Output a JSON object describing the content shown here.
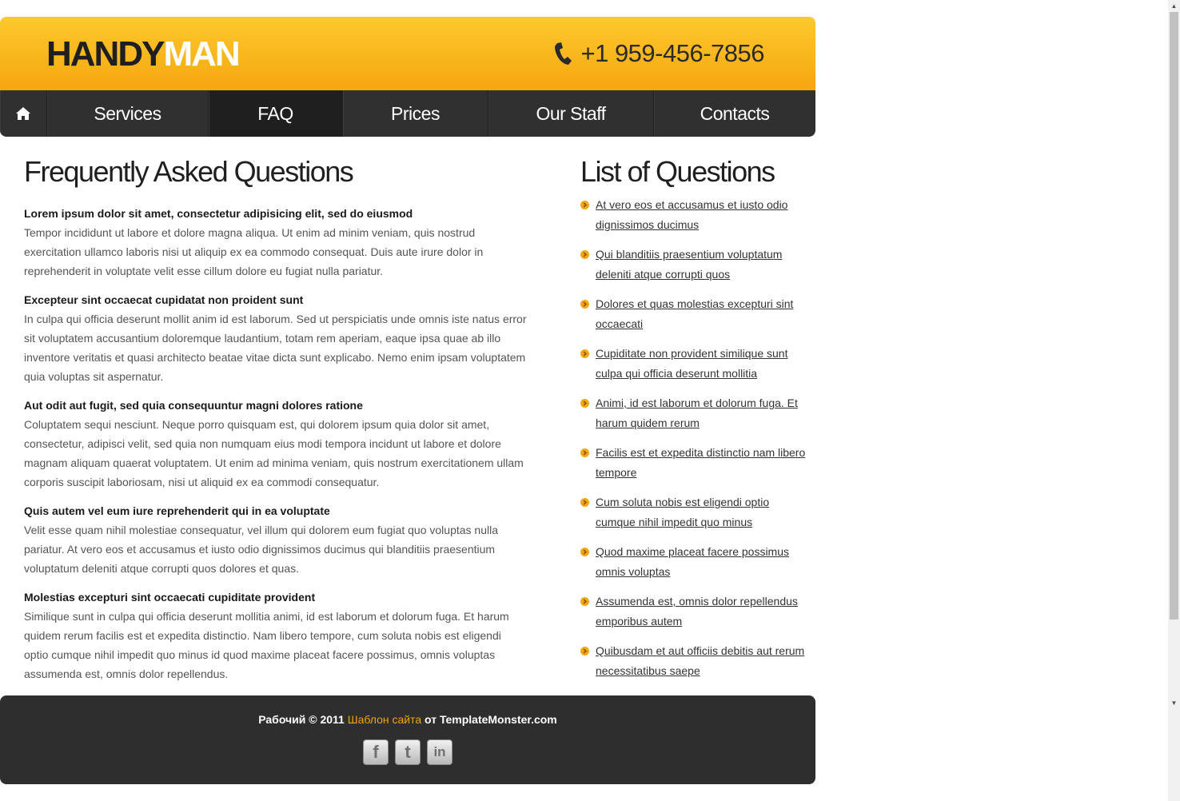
{
  "header": {
    "logo_part1": "HANDY",
    "logo_part2": "MAN",
    "phone": "+1 959-456-7856"
  },
  "nav": {
    "home_icon": "home-icon",
    "items": [
      {
        "label": "Services"
      },
      {
        "label": "FAQ",
        "active": true
      },
      {
        "label": "Prices"
      },
      {
        "label": "Our Staff"
      },
      {
        "label": "Contacts"
      }
    ]
  },
  "faq": {
    "title": "Frequently Asked Questions",
    "items": [
      {
        "question": "Lorem ipsum dolor sit amet, consectetur adipisicing elit, sed do eiusmod",
        "answer": "Tempor incididunt ut labore et dolore magna aliqua. Ut enim ad minim veniam, quis nostrud exercitation ullamco laboris nisi ut aliquip ex ea commodo consequat. Duis aute irure dolor in reprehenderit in voluptate velit esse cillum dolore eu fugiat nulla pariatur."
      },
      {
        "question": "Excepteur sint occaecat cupidatat non proident sunt",
        "answer": "In culpa qui officia deserunt mollit anim id est laborum. Sed ut perspiciatis unde omnis iste natus error sit voluptatem accusantium doloremque laudantium, totam rem aperiam, eaque ipsa quae ab illo inventore veritatis et quasi architecto beatae vitae dicta sunt explicabo. Nemo enim ipsam voluptatem quia voluptas sit aspernatur."
      },
      {
        "question": "Aut odit aut fugit, sed quia consequuntur magni dolores ratione",
        "answer": "Coluptatem sequi nesciunt. Neque porro quisquam est, qui dolorem ipsum quia dolor sit amet, consectetur, adipisci velit, sed quia non numquam eius modi tempora incidunt ut labore et dolore magnam aliquam quaerat voluptatem. Ut enim ad minima veniam, quis nostrum exercitationem ullam corporis suscipit laboriosam, nisi ut aliquid ex ea commodi consequatur."
      },
      {
        "question": "Quis autem vel eum iure reprehenderit qui in ea voluptate",
        "answer": "Velit esse quam nihil molestiae consequatur, vel illum qui dolorem eum fugiat quo voluptas nulla pariatur. At vero eos et accusamus et iusto odio dignissimos ducimus qui blanditiis praesentium voluptatum deleniti atque corrupti quos dolores et quas."
      },
      {
        "question": "Molestias excepturi sint occaecati cupiditate provident",
        "answer": "Similique sunt in culpa qui officia deserunt mollitia animi, id est laborum et dolorum fuga. Et harum quidem rerum facilis est et expedita distinctio. Nam libero tempore, cum soluta nobis est eligendi optio cumque nihil impedit quo minus id quod maxime placeat facere possimus, omnis voluptas assumenda est, omnis dolor repellendus."
      }
    ]
  },
  "questions_list": {
    "title": "List of Questions",
    "items": [
      "At vero eos et accusamus et iusto odio dignissimos ducimus",
      "Qui blanditiis praesentium voluptatum deleniti atque corrupti quos",
      "Dolores et quas molestias excepturi sint occaecati",
      "Cupiditate non provident similique sunt culpa qui officia deserunt mollitia",
      "Animi, id est laborum et dolorum fuga. Et harum quidem rerum",
      "Facilis est et expedita distinctio nam libero tempore",
      "Cum soluta nobis est eligendi optio cumque nihil impedit quo minus",
      "Quod maxime placeat facere possimus omnis voluptas",
      "Assumenda est, omnis dolor repellendus emporibus autem",
      "Quibusdam et aut officiis debitis aut rerum necessitatibus saepe"
    ]
  },
  "footer": {
    "copyright_prefix": "Рабочий © 2011",
    "link": "Шаблон сайта",
    "copyright_suffix": "от TemplateMonster.com",
    "social": [
      {
        "name": "facebook-icon",
        "glyph": "f"
      },
      {
        "name": "twitter-icon",
        "glyph": "t"
      },
      {
        "name": "linkedin-icon",
        "glyph": "in"
      }
    ]
  },
  "colors": {
    "accent": "#f6a611",
    "nav_bg": "#303030",
    "footer_bg": "#2e2e2e"
  }
}
